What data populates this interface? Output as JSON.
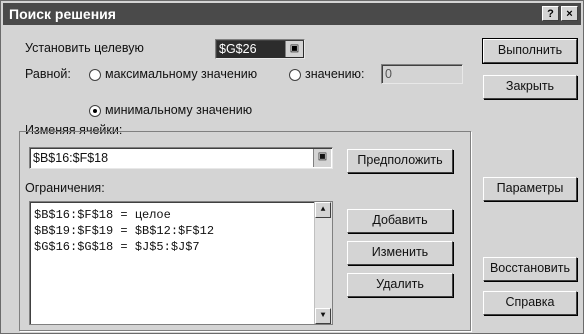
{
  "dialog": {
    "title": "Поиск решения",
    "help_label": "?",
    "close_label": "×"
  },
  "target": {
    "label": "Установить целевую",
    "value": "$G$26",
    "ref_icon": "collapse-dialog-icon"
  },
  "equal": {
    "label": "Равной:",
    "option_max": "максимальному значению",
    "option_value": "значению:",
    "option_min": "минимальному значению",
    "value_field": "0",
    "selected": "min"
  },
  "changing": {
    "label": "Изменяя ячейки:",
    "value": "$B$16:$F$18",
    "guess_button": "Предположить"
  },
  "constraints": {
    "label": "Ограничения:",
    "items": [
      "$B$16:$F$18 = целое",
      "$B$19:$F$19 = $B$12:$F$12",
      "$G$16:$G$18 = $J$5:$J$7"
    ],
    "add_button": "Добавить",
    "change_button": "Изменить",
    "delete_button": "Удалить"
  },
  "right_buttons": {
    "solve": "Выполнить",
    "close": "Закрыть",
    "options": "Параметры",
    "reset": "Восстановить",
    "help": "Справка"
  }
}
